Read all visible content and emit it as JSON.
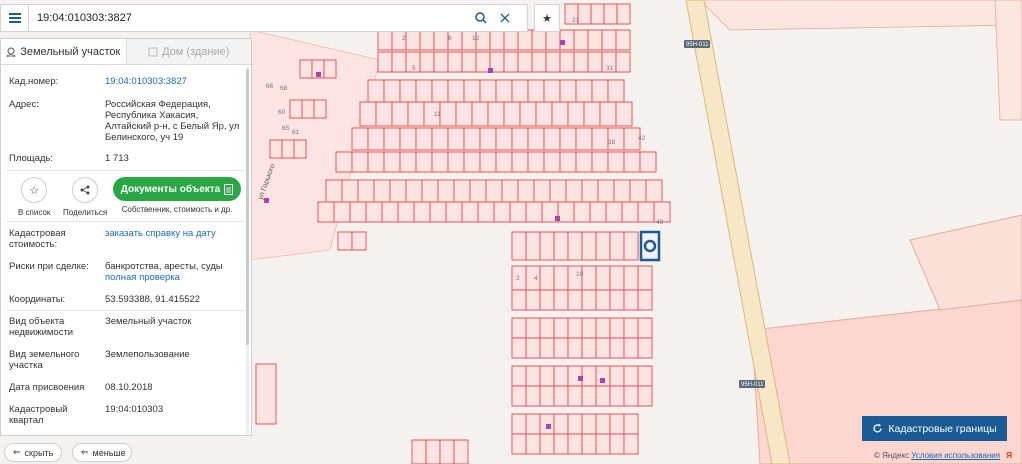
{
  "search": {
    "value": "19:04:010303:3827"
  },
  "tabs": [
    {
      "label": "Земельный участок"
    },
    {
      "label": "Дом (здание)"
    }
  ],
  "info": {
    "cad_label": "Кад.номер:",
    "cad_value": "19:04:010303:3827",
    "addr_label": "Адрес:",
    "addr_value": "Российская Федерация, Республика Хакасия, Алтайский р-н, с Белый Яр, ул Белинского, уч 19",
    "area_label": "Площадь:",
    "area_value": "1 713",
    "cost_label": "Кадастровая стоимость:",
    "cost_value": "заказать справку на дату",
    "risk_label": "Риски при сделке:",
    "risk_value": "банкротства, аресты, суды",
    "risk_link": "полная проверка",
    "coord_label": "Координаты:",
    "coord_value": "53.593388, 91.415522",
    "type_label": "Вид объекта недвижимости",
    "type_value": "Земельный участок",
    "landuse_label": "Вид земельного участка",
    "landuse_value": "Землепользование",
    "date_label": "Дата присвоения",
    "date_value": "08.10.2018",
    "quarter_label": "Кадастровый квартал",
    "quarter_value": "19:04:010303"
  },
  "actions": {
    "list_label": "В список",
    "share_label": "Поделиться",
    "docs_label": "Документы объекта",
    "docs_sub": "Собственник, стоимость и др."
  },
  "bottom": {
    "hide_label": "скрыть",
    "less_label": "меньше",
    "cad_borders": "Кадастровые границы",
    "attrib_copy": "© Яндекс",
    "attrib_link": "Условия использования",
    "attrib_logo": "Я"
  },
  "map": {
    "road_label_1": "95Н-011",
    "road_label_2": "95Н-011",
    "street_label": "ул Горького",
    "plot_numbers": [
      "2",
      "6",
      "12",
      "21",
      "5",
      "31",
      "11",
      "38",
      "42",
      "49",
      "2",
      "4",
      "10",
      "68",
      "66",
      "65",
      "61",
      "60"
    ]
  },
  "colors": {
    "plot_fill": "#fbe4e2",
    "plot_stroke": "#e04848",
    "zone_fill": "#fcd6cf",
    "accent": "#1a5b95",
    "green": "#29a745",
    "selected": "#1a5b95"
  }
}
